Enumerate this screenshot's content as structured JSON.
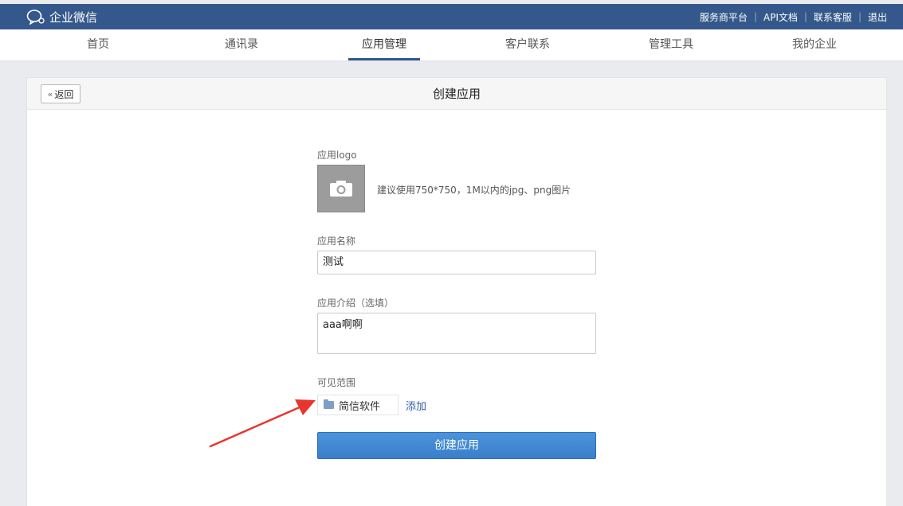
{
  "brand": {
    "name": "企业微信"
  },
  "toplinks": [
    "服务商平台",
    "API文档",
    "联系客服",
    "退出"
  ],
  "nav": [
    "首页",
    "通讯录",
    "应用管理",
    "客户联系",
    "管理工具",
    "我的企业"
  ],
  "nav_active": "应用管理",
  "panel": {
    "back_label": "返回",
    "title": "创建应用"
  },
  "form": {
    "logo_label": "应用logo",
    "logo_hint": "建议使用750*750，1M以内的jpg、png图片",
    "name_label": "应用名称",
    "name_value": "测试",
    "desc_label": "应用介绍（选填）",
    "desc_value": "aaa啊啊",
    "scope_label": "可见范围",
    "scope_item": "简信软件",
    "add_label": "添加",
    "submit_label": "创建应用"
  },
  "colors": {
    "header_bg": "#34588b",
    "primary_button": "#3a7fc9",
    "annotation_arrow": "#e8352e"
  }
}
